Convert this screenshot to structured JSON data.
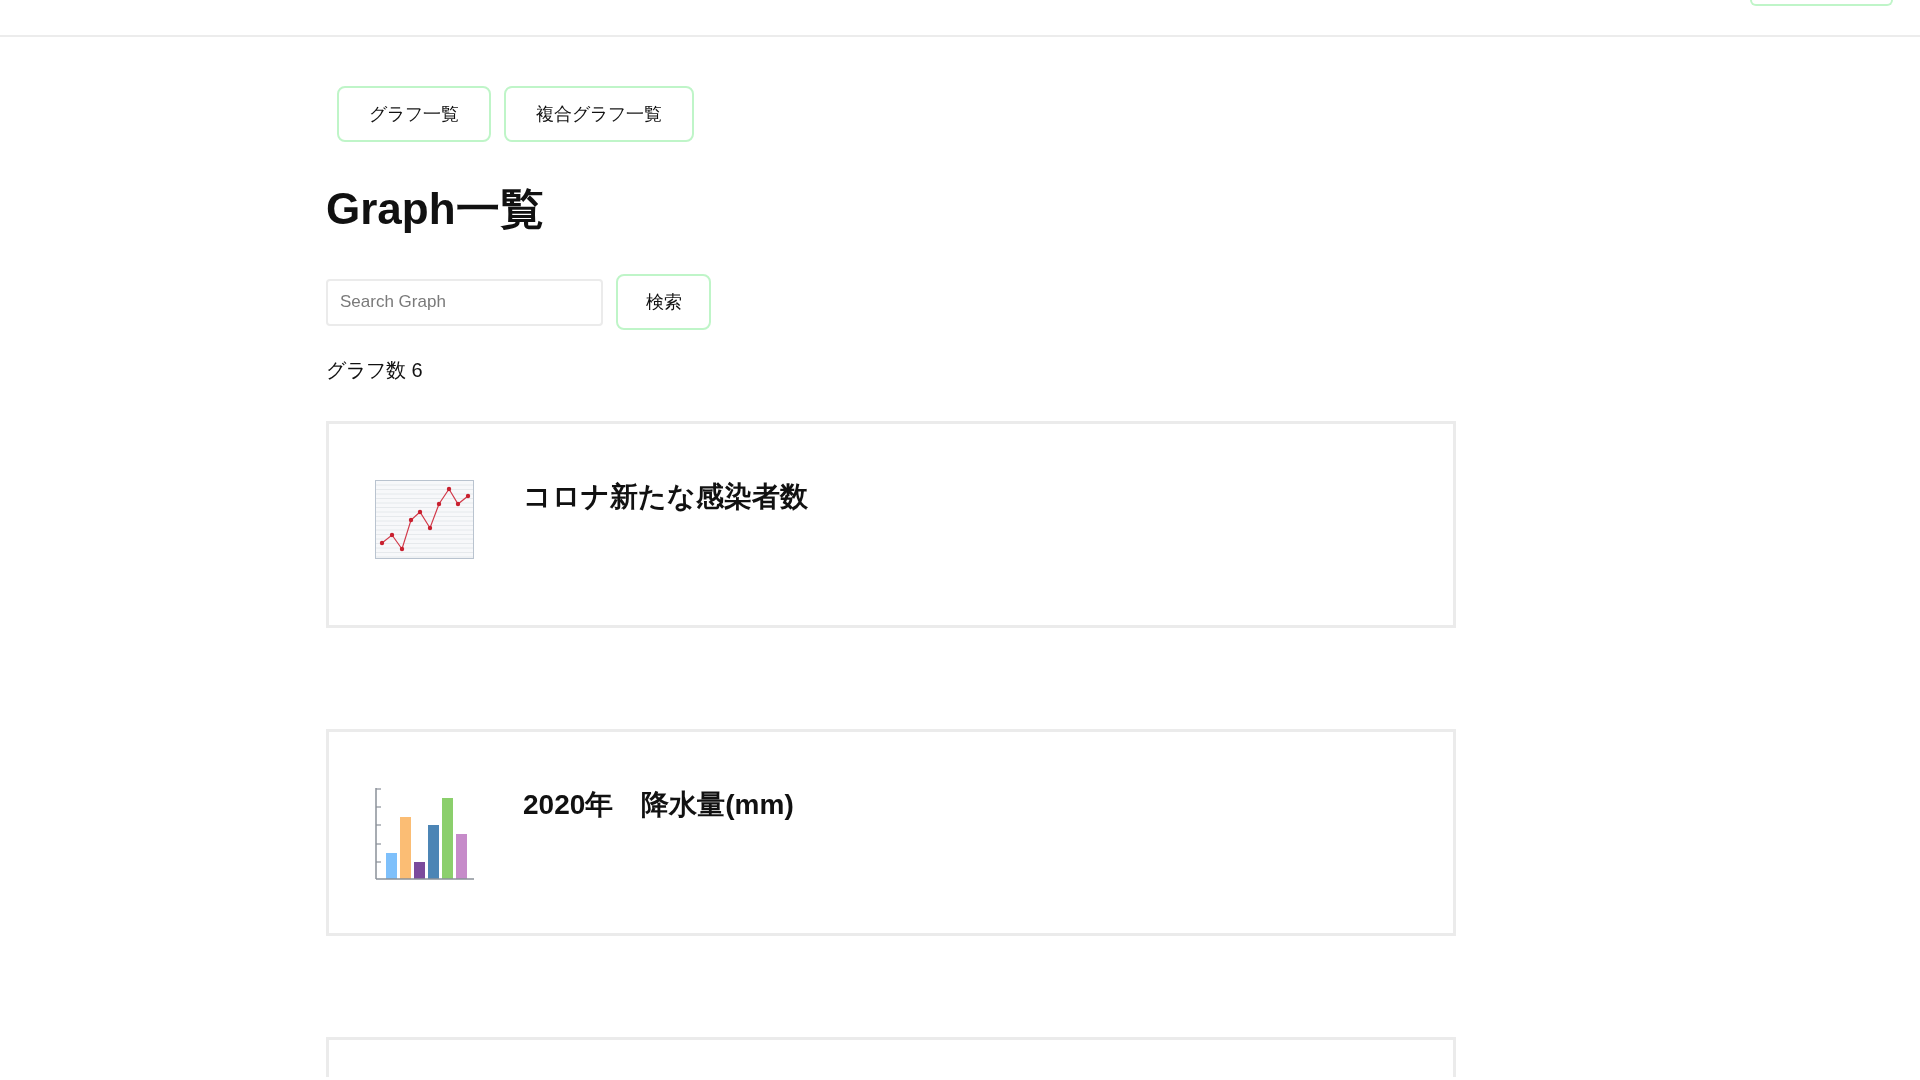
{
  "nav": {
    "tabs": [
      {
        "label": "グラフ一覧"
      },
      {
        "label": "複合グラフ一覧"
      }
    ]
  },
  "heading": "Graph一覧",
  "search": {
    "placeholder": "Search Graph",
    "button": "検索"
  },
  "count": "グラフ数 6",
  "graphs": [
    {
      "kind": "line",
      "title": "コロナ新たな感染者数"
    },
    {
      "kind": "bar",
      "title": "2020年　降水量(mm)"
    }
  ]
}
